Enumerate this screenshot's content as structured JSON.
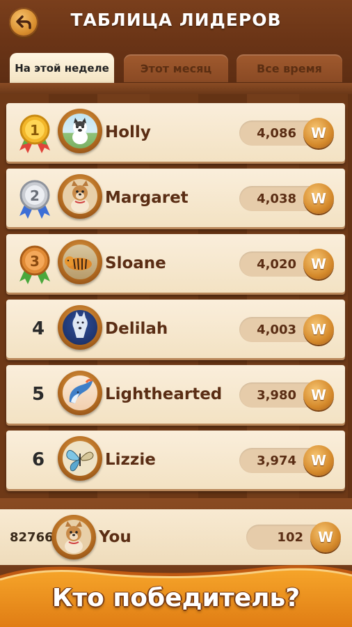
{
  "header": {
    "title": "ТАБЛИЦА ЛИДЕРОВ"
  },
  "tabs": [
    {
      "label": "На этой неделе",
      "active": true
    },
    {
      "label": "Этот месяц",
      "active": false
    },
    {
      "label": "Все время",
      "active": false
    }
  ],
  "leaderboard": [
    {
      "rank": "1",
      "name": "Holly",
      "score": "4,086",
      "medal": "gold",
      "avatar": "dog-icon"
    },
    {
      "rank": "2",
      "name": "Margaret",
      "score": "4,038",
      "medal": "silver",
      "avatar": "dog-icon"
    },
    {
      "rank": "3",
      "name": "Sloane",
      "score": "4,020",
      "medal": "bronze",
      "avatar": "tiger-icon"
    },
    {
      "rank": "4",
      "name": "Delilah",
      "score": "4,003",
      "avatar": "wolf-icon"
    },
    {
      "rank": "5",
      "name": "Lighthearted",
      "score": "3,980",
      "avatar": "whale-icon"
    },
    {
      "rank": "6",
      "name": "Lizzie",
      "score": "3,974",
      "avatar": "butterfly-icon"
    }
  ],
  "you": {
    "rank": "82766",
    "name": "You",
    "score": "102",
    "avatar": "dog-icon"
  },
  "coin_symbol": "W",
  "banner": {
    "text": "Кто победитель?"
  },
  "colors": {
    "gold": "#f2b62a",
    "silver": "#c9ccd2",
    "bronze": "#e08a35",
    "wood": "#6e3917",
    "text_brown": "#5a2d14"
  }
}
